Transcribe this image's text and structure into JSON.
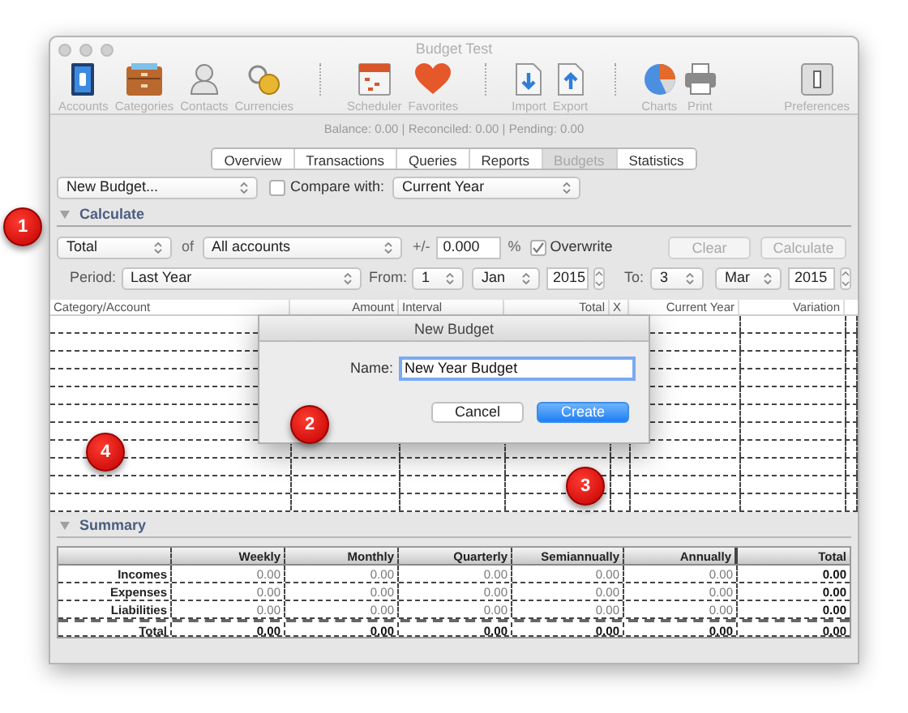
{
  "window": {
    "title": "Budget Test"
  },
  "toolbar": {
    "groups": [
      [
        {
          "label": "Accounts"
        },
        {
          "label": "Categories"
        },
        {
          "label": "Contacts"
        },
        {
          "label": "Currencies"
        }
      ],
      [
        {
          "label": "Scheduler"
        },
        {
          "label": "Favorites"
        }
      ],
      [
        {
          "label": "Import"
        },
        {
          "label": "Export"
        }
      ],
      [
        {
          "label": "Charts"
        },
        {
          "label": "Print"
        }
      ]
    ],
    "right": [
      {
        "label": "Preferences"
      }
    ]
  },
  "status": "Balance: 0.00 | Reconciled: 0.00 | Pending: 0.00",
  "tabs": [
    {
      "label": "Overview",
      "selected": false
    },
    {
      "label": "Transactions",
      "selected": false
    },
    {
      "label": "Queries",
      "selected": false
    },
    {
      "label": "Reports",
      "selected": false
    },
    {
      "label": "Budgets",
      "selected": true
    },
    {
      "label": "Statistics",
      "selected": false
    }
  ],
  "budget_select": {
    "value": "New Budget..."
  },
  "compare": {
    "label": "Compare with:",
    "checked": false
  },
  "compare_select": {
    "value": "Current Year"
  },
  "calculate": {
    "title": "Calculate",
    "mode_select": "Total",
    "of_label": "of",
    "accounts_select": "All accounts",
    "plusminus_label": "+/-",
    "percent_field": "0.000",
    "percent_label": "%",
    "overwrite": {
      "label": "Overwrite",
      "checked": true
    },
    "buttons": [
      {
        "label": "Clear",
        "disabled": true
      },
      {
        "label": "Calculate",
        "disabled": true
      }
    ],
    "period_label": "Period:",
    "period_select": "Last Year",
    "from_label": "From:",
    "from_day": "1",
    "from_month": "Jan",
    "from_year": "2015",
    "to_label": "To:",
    "to_day": "3",
    "to_month": "Mar",
    "to_year": "2015"
  },
  "table": {
    "columns": [
      "Category/Account",
      "Amount",
      "Interval",
      "Total",
      "X",
      "Current Year",
      "Variation"
    ]
  },
  "dialog": {
    "title": "New Budget",
    "name_label": "Name:",
    "name_value": "New Year Budget",
    "buttons": [
      {
        "label": "Cancel",
        "default": false
      },
      {
        "label": "Create",
        "default": true
      }
    ]
  },
  "summary": {
    "title": "Summary",
    "columns": [
      "Weekly",
      "Monthly",
      "Quarterly",
      "Semiannually",
      "Annually",
      "Total"
    ],
    "rows": [
      {
        "label": "Incomes",
        "kind": "normal",
        "cells": [
          "0.00",
          "0.00",
          "0.00",
          "0.00",
          "0.00",
          "0.00"
        ]
      },
      {
        "label": "Expenses",
        "kind": "normal",
        "cells": [
          "0.00",
          "0.00",
          "0.00",
          "0.00",
          "0.00",
          "0.00"
        ]
      },
      {
        "label": "Liabilities",
        "kind": "normal",
        "cells": [
          "0.00",
          "0.00",
          "0.00",
          "0.00",
          "0.00",
          "0.00"
        ]
      },
      {
        "label": "Total",
        "kind": "total",
        "cells": [
          "0.00",
          "0.00",
          "0.00",
          "0.00",
          "0.00",
          "0.00"
        ]
      }
    ]
  },
  "markers": [
    {
      "number": "1"
    },
    {
      "number": "2"
    },
    {
      "number": "3"
    },
    {
      "number": "4"
    }
  ]
}
